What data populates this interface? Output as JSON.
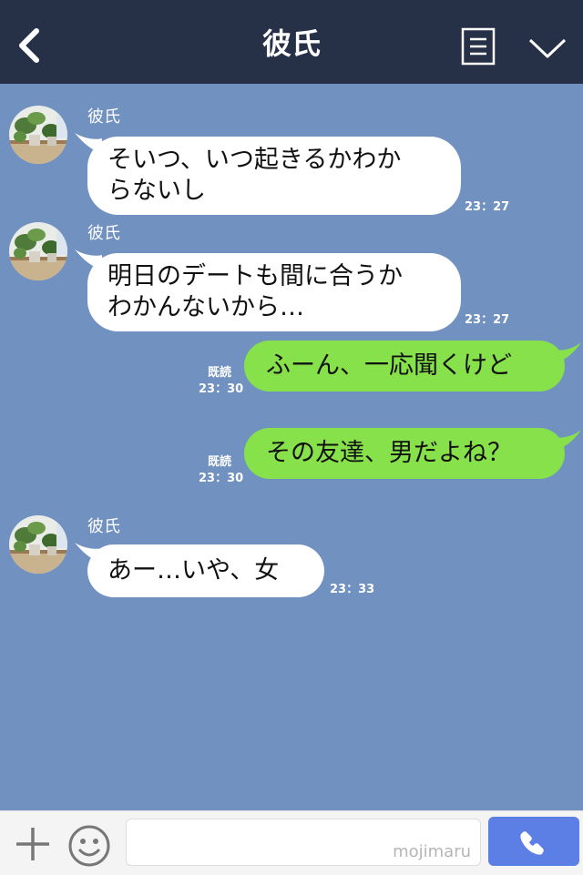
{
  "header": {
    "title": "彼氏"
  },
  "messages": [
    {
      "sender": "彼氏",
      "lines": [
        "そいつ、いつ起きるかわか",
        "らないし"
      ],
      "time": "23：27"
    },
    {
      "sender": "彼氏",
      "lines": [
        "明日のデートも間に合うか",
        "わかんないから…"
      ],
      "time": "23：27"
    },
    {
      "text": "ふーん、一応聞くけど",
      "read": "既読",
      "time": "23：30"
    },
    {
      "text": "その友達、男だよね？",
      "read": "既読",
      "time": "23：30"
    },
    {
      "sender": "彼氏",
      "text": "あー…いや、女",
      "time": "23：33"
    }
  ],
  "footer": {
    "watermark": "mojimaru"
  },
  "colors": {
    "header_bg": "#263047",
    "chat_bg": "#7191c1",
    "outgoing_bubble": "#86e14a",
    "call_button": "#5b7fe4"
  },
  "icons": [
    "back-arrow-icon",
    "menu-list-icon",
    "chevron-down-icon",
    "plus-icon",
    "smiley-icon",
    "phone-icon"
  ]
}
